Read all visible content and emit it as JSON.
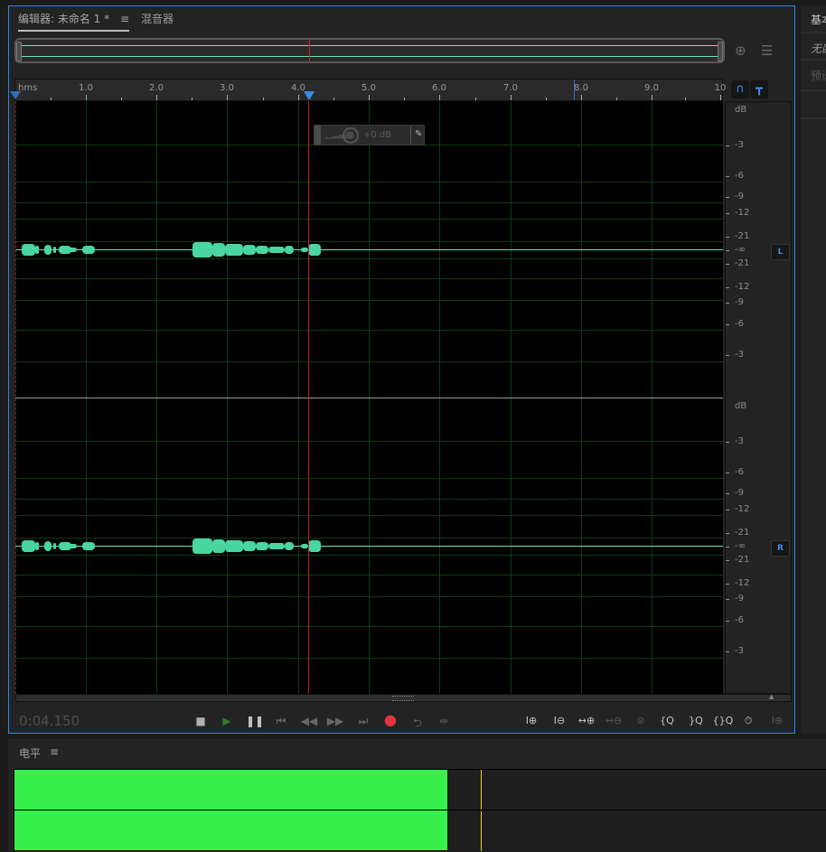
{
  "editor": {
    "tabs": [
      {
        "label": "编辑器: 未命名 1 *",
        "menu_icon": "≡",
        "active": true
      },
      {
        "label": "混音器",
        "active": false
      }
    ],
    "zoom_nav_icon": "zoom-navigator-icon",
    "overview_icon": "list-icon",
    "ruler": {
      "unit_label": "hms",
      "ticks": [
        "1.0",
        "2.0",
        "3.0",
        "4.0",
        "5.0",
        "6.0",
        "7.0",
        "8.0",
        "9.0",
        "10"
      ]
    },
    "snap_icon": "magnet-icon",
    "marker_icon": "marker-icon",
    "hud": {
      "volume_label": "+0 dB"
    },
    "db_scale": {
      "unit": "dB",
      "labels_top": [
        "-3",
        "-6",
        "-9",
        "-12",
        "-21",
        "-∞",
        "-21",
        "-12",
        "-9",
        "-6",
        "-3"
      ]
    },
    "channels": [
      {
        "label": "L",
        "color": "#3a8ce8"
      },
      {
        "label": "R",
        "color": "#3a8ce8"
      }
    ],
    "playhead_time": "0:04.150",
    "transport": [
      {
        "name": "stop-button",
        "glyph": "■"
      },
      {
        "name": "play-button",
        "glyph": "▶"
      },
      {
        "name": "pause-button",
        "glyph": "❚❚"
      },
      {
        "name": "go-to-start-button",
        "glyph": "⏮"
      },
      {
        "name": "rewind-button",
        "glyph": "◀◀"
      },
      {
        "name": "fast-forward-button",
        "glyph": "▶▶"
      },
      {
        "name": "go-to-end-button",
        "glyph": "⏭"
      },
      {
        "name": "record-button",
        "glyph": "●"
      },
      {
        "name": "loop-playback-button",
        "glyph": "⮌"
      },
      {
        "name": "skip-selection-button",
        "glyph": "⇹"
      }
    ],
    "zoom_tools": [
      {
        "name": "zoom-in-amplitude-button",
        "glyph": "I⊕"
      },
      {
        "name": "zoom-out-amplitude-button",
        "glyph": "I⊖"
      },
      {
        "name": "zoom-in-time-button",
        "glyph": "↔⊕"
      },
      {
        "name": "zoom-out-time-button",
        "glyph": "↔⊖"
      },
      {
        "name": "zoom-out-full-button",
        "glyph": "⊛"
      },
      {
        "name": "zoom-in-at-in-point-button",
        "glyph": "{Q"
      },
      {
        "name": "zoom-in-at-out-point-button",
        "glyph": "}Q"
      },
      {
        "name": "zoom-to-selection-button",
        "glyph": "{}Q"
      },
      {
        "name": "zoom-to-time-button",
        "glyph": "⏱"
      },
      {
        "name": "zoom-selected-tracks-button",
        "glyph": "I⊕"
      }
    ]
  },
  "levels": {
    "title": "电平",
    "menu_icon": "≡",
    "left_level_pct": 53.3,
    "right_level_pct": 53.3,
    "peak_pct": 57.4
  },
  "right_panel": {
    "items": [
      "基本",
      "无匹",
      "预设"
    ]
  }
}
